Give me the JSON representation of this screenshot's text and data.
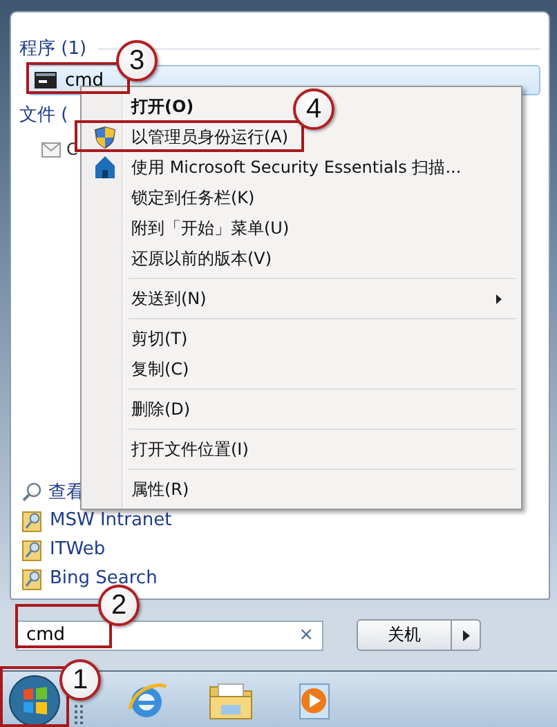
{
  "start_menu": {
    "programs_header": "程序 (1)",
    "programs": [
      {
        "label": "cmd",
        "selected": true
      }
    ],
    "files_header": "文件 (",
    "files": [
      {
        "label": "C"
      }
    ],
    "links": [
      {
        "label": "查看",
        "kind": "search"
      },
      {
        "label": "MSW Intranet",
        "kind": "web"
      },
      {
        "label": "ITWeb",
        "kind": "web"
      },
      {
        "label": "Bing Search",
        "kind": "web"
      }
    ],
    "search": {
      "value": "cmd",
      "clear": "×"
    },
    "shutdown": {
      "label": "关机"
    }
  },
  "context_menu": {
    "groups": [
      [
        {
          "label": "打开(O)",
          "bold": true,
          "kind": "plain"
        },
        {
          "label": "以管理员身份运行(A)",
          "bold": false,
          "kind": "shield"
        },
        {
          "label": "使用 Microsoft Security Essentials 扫描...",
          "bold": false,
          "kind": "scanner"
        },
        {
          "label": "锁定到任务栏(K)",
          "bold": false,
          "kind": "plain"
        },
        {
          "label": "附到「开始」菜单(U)",
          "bold": false,
          "kind": "plain"
        },
        {
          "label": "还原以前的版本(V)",
          "bold": false,
          "kind": "plain"
        }
      ],
      [
        {
          "label": "发送到(N)",
          "bold": false,
          "kind": "submenu"
        }
      ],
      [
        {
          "label": "剪切(T)",
          "bold": false,
          "kind": "plain"
        },
        {
          "label": "复制(C)",
          "bold": false,
          "kind": "plain"
        }
      ],
      [
        {
          "label": "删除(D)",
          "bold": false,
          "kind": "plain"
        }
      ],
      [
        {
          "label": "打开文件位置(I)",
          "bold": false,
          "kind": "plain"
        }
      ],
      [
        {
          "label": "属性(R)",
          "bold": false,
          "kind": "plain"
        }
      ]
    ]
  },
  "callouts": [
    {
      "number": "1"
    },
    {
      "number": "2"
    },
    {
      "number": "3"
    },
    {
      "number": "4"
    }
  ]
}
